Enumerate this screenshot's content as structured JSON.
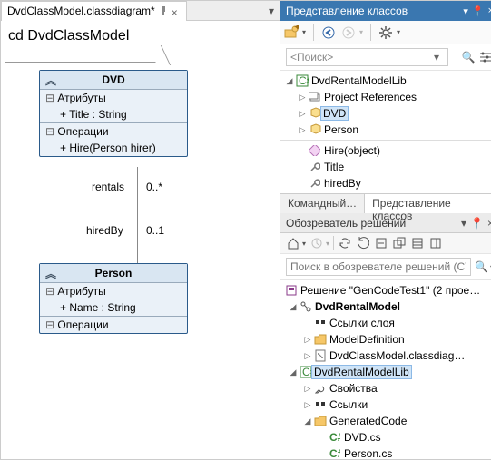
{
  "doc_tab": {
    "title": "DvdClassModel.classdiagram*"
  },
  "diagram": {
    "title": "cd DvdClassModel",
    "dvd": {
      "name": "DVD",
      "attr_header": "Атрибуты",
      "attr1": "+ Title : String",
      "op_header": "Операции",
      "op1": "+ Hire(Person hirer)"
    },
    "person": {
      "name": "Person",
      "attr_header": "Атрибуты",
      "attr1": "+ Name : String",
      "op_header": "Операции"
    },
    "assoc": {
      "rentals_label": "rentals",
      "rentals_mult": "0..*",
      "hiredby_label": "hiredBy",
      "hiredby_mult": "0..1"
    }
  },
  "class_view": {
    "panel_title": "Представление классов",
    "search_placeholder": "<Поиск>",
    "tree": {
      "root": "DvdRentalModelLib",
      "proj_refs": "Project References",
      "dvd": "DVD",
      "person": "Person"
    },
    "members": {
      "hire": "Hire(object)",
      "title": "Title",
      "hiredBy": "hiredBy"
    },
    "bottom_tabs": {
      "cmd": "Командный…",
      "cls": "Представление классов"
    }
  },
  "soln": {
    "panel_title": "Обозреватель решений",
    "search_placeholder": "Поиск в обозревателе решений (CTRL+;)",
    "root": "Решение \"GenCodeTest1\" (2 прое…",
    "model_proj": "DvdRentalModel",
    "layer_refs": "Ссылки слоя",
    "model_def": "ModelDefinition",
    "classdiag": "DvdClassModel.classdiag…",
    "lib_proj": "DvdRentalModelLib",
    "props": "Свойства",
    "refs": "Ссылки",
    "gen": "GeneratedCode",
    "dvd_cs": "DVD.cs",
    "person_cs": "Person.cs"
  },
  "glyphs": {
    "pin": "📌",
    "close": "×",
    "drop": "▾",
    "search": "🔍",
    "settings": "⚙",
    "back": "⬅",
    "fwd": "➡",
    "home": "⌂",
    "refresh": "⟳",
    "collapse": "⇱"
  }
}
